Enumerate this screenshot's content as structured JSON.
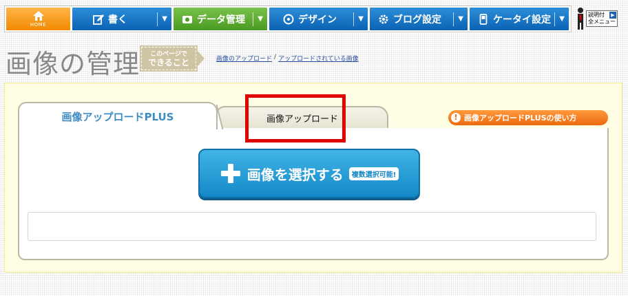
{
  "nav": {
    "home_label": "HOME",
    "items": [
      {
        "label": "書く",
        "icon": "pencil-icon",
        "color": "blue"
      },
      {
        "label": "データ管理",
        "icon": "camera-icon",
        "color": "green"
      },
      {
        "label": "デザイン",
        "icon": "palette-icon",
        "color": "blue"
      },
      {
        "label": "ブログ設定",
        "icon": "gear-icon",
        "color": "blue"
      },
      {
        "label": "ケータイ設定",
        "icon": "mobile-phone-icon",
        "color": "blue"
      }
    ],
    "help": {
      "line1": "説明付",
      "line2": "全メニュー"
    }
  },
  "header": {
    "title": "画像の管理",
    "this_page_line1": "このページで",
    "this_page_line2": "できること",
    "breadcrumb": [
      "画像のアップロード",
      "アップロードされている画像"
    ],
    "breadcrumb_separator": "/"
  },
  "tabs": {
    "active": "画像アップロードPLUS",
    "inactive": "画像アップロード",
    "howto": "画像アップロードPLUSの使い方"
  },
  "upload": {
    "select_label": "画像を選択する",
    "multi_badge": "複数選択可能!"
  },
  "colors": {
    "nav_home": "#f28a00",
    "nav_blue": "#0a62b3",
    "nav_green": "#4a9a22",
    "tab_active_text": "#3d8cc4",
    "highlight": "#e00000",
    "howto_button": "#ec6a0e",
    "select_button": "#1489c7",
    "panel_background": "#fffde4"
  }
}
